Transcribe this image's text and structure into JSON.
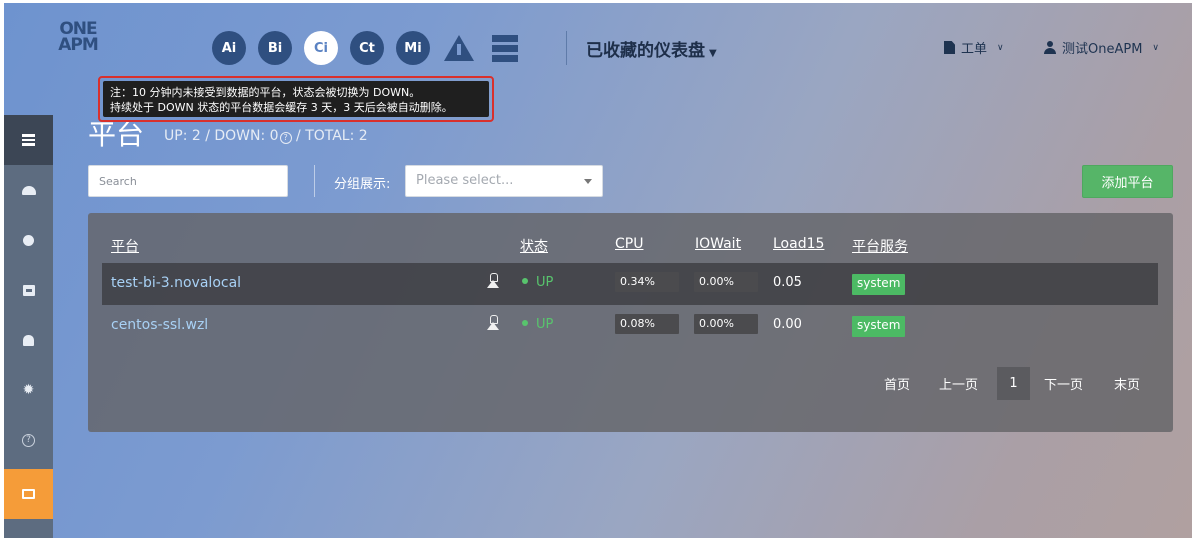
{
  "topbar": {
    "logo_line1": "ONE",
    "logo_line2": "APM",
    "product_icons": [
      "Ai",
      "Bi",
      "Ci",
      "Ct",
      "Mi"
    ],
    "dashboard_label": "已收藏的仪表盘",
    "ticket_label": "工单",
    "user_label": "测试OneAPM"
  },
  "tooltip": {
    "line1": "注：10 分钟内未接受到数据的平台，状态会被切换为 DOWN。",
    "line2": "持续处于 DOWN 状态的平台数据会缓存 3 天，3 天后会被自动删除。"
  },
  "page": {
    "title": "平台",
    "stats": "UP: 2 / DOWN: 0",
    "stats_total": " / TOTAL: 2",
    "help_mark": "?"
  },
  "filters": {
    "search_placeholder": "Search",
    "group_label": "分组展示:",
    "group_placeholder": "Please select...",
    "add_button": "添加平台"
  },
  "table": {
    "headers": {
      "platform": "平台",
      "status": "状态",
      "cpu": "CPU",
      "iowait": "IOWait",
      "load15": "Load15",
      "services": "平台服务"
    },
    "rows": [
      {
        "host": "test-bi-3.novalocal",
        "status": "UP",
        "cpu": "0.34%",
        "iowait": "0.00%",
        "load15": "0.05",
        "service": "system"
      },
      {
        "host": "centos-ssl.wzl",
        "status": "UP",
        "cpu": "0.08%",
        "iowait": "0.00%",
        "load15": "0.00",
        "service": "system"
      }
    ]
  },
  "pagination": {
    "first": "首页",
    "prev": "上一页",
    "current": "1",
    "next": "下一页",
    "last": "末页"
  },
  "colors": {
    "accent_green": "#56b568",
    "status_up": "#58c46d",
    "sidebar_orange": "#f59c39",
    "tooltip_border": "#d9302c"
  }
}
